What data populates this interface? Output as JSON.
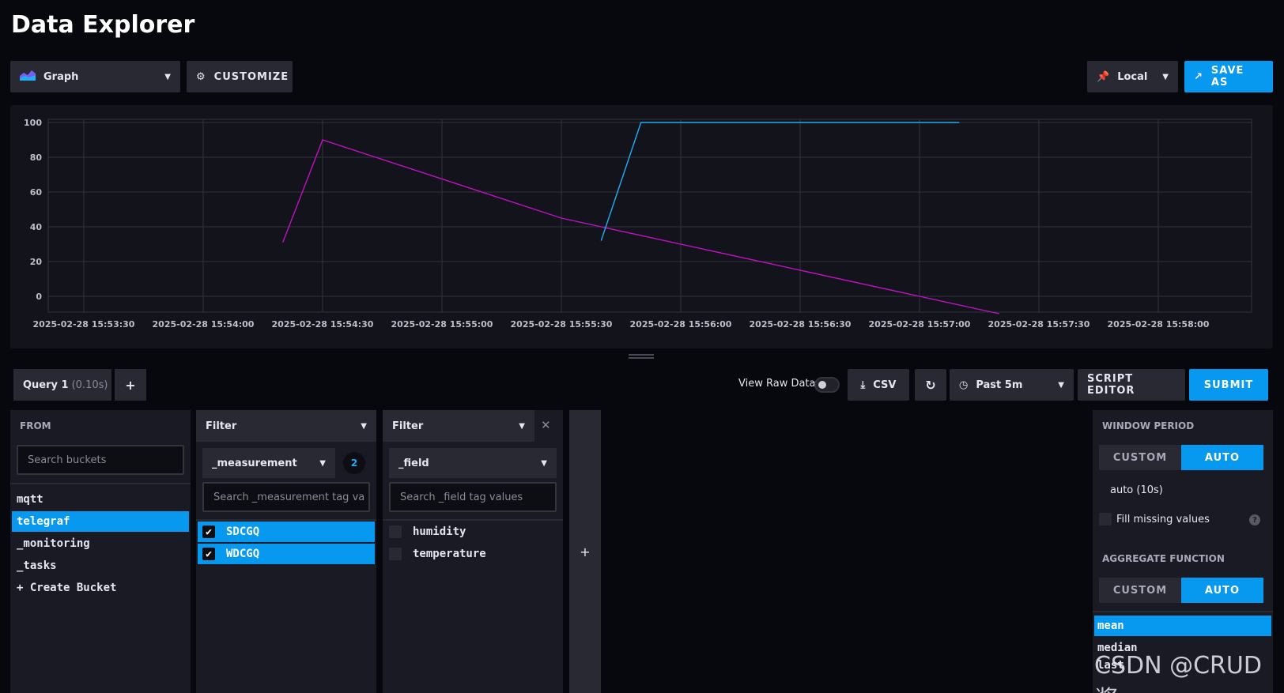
{
  "page": {
    "title": "Data Explorer"
  },
  "toolbar": {
    "graph_label": "Graph",
    "customize_label": "CUSTOMIZE",
    "timezone_label": "Local",
    "save_as_label": "SAVE AS"
  },
  "chart_data": {
    "type": "line",
    "ylim": [
      0,
      100
    ],
    "yticks": [
      "100",
      "80",
      "60",
      "40",
      "20",
      "0"
    ],
    "xticks": [
      "2025-02-28 15:53:30",
      "2025-02-28 15:54:00",
      "2025-02-28 15:54:30",
      "2025-02-28 15:55:00",
      "2025-02-28 15:55:30",
      "2025-02-28 15:56:00",
      "2025-02-28 15:56:30",
      "2025-02-28 15:57:00",
      "2025-02-28 15:57:30",
      "2025-02-28 15:58:00"
    ],
    "grid": true,
    "series": [
      {
        "color": "#c012c0",
        "x": [
          "2025-02-28 15:54:20",
          "2025-02-28 15:54:30",
          "2025-02-28 15:55:30",
          "2025-02-28 15:57:00",
          "2025-02-28 15:57:20"
        ],
        "y": [
          31,
          90,
          45,
          0,
          -10
        ]
      },
      {
        "color": "#22adf6",
        "x": [
          "2025-02-28 15:55:40",
          "2025-02-28 15:55:50",
          "2025-02-28 15:57:10"
        ],
        "y": [
          32,
          100,
          100
        ]
      }
    ]
  },
  "query": {
    "tab_name": "Query 1",
    "tab_time": "(0.10s)",
    "add_label": "+",
    "view_raw_label": "View Raw Data",
    "csv_label": "CSV",
    "time_range_label": "Past 5m",
    "script_editor_label": "SCRIPT EDITOR",
    "submit_label": "SUBMIT"
  },
  "from": {
    "header": "FROM",
    "search_placeholder": "Search buckets",
    "buckets": [
      "mqtt",
      "telegraf",
      "_monitoring",
      "_tasks"
    ],
    "selected": "telegraf",
    "create_label": "+ Create Bucket"
  },
  "filter1": {
    "header": "Filter",
    "key": "_measurement",
    "count": "2",
    "search_placeholder": "Search _measurement tag va",
    "values": [
      "SDCGQ",
      "WDCGQ"
    ]
  },
  "filter2": {
    "header": "Filter",
    "close_label": "✕",
    "key": "_field",
    "search_placeholder": "Search _field tag values",
    "values": [
      "humidity",
      "temperature"
    ]
  },
  "add_column_label": "+",
  "window": {
    "header": "WINDOW PERIOD",
    "custom_label": "CUSTOM",
    "auto_label": "AUTO",
    "period": "auto (10s)",
    "fill_label": "Fill missing values",
    "help_label": "?"
  },
  "aggregate": {
    "header": "AGGREGATE FUNCTION",
    "custom_label": "CUSTOM",
    "auto_label": "AUTO",
    "functions": [
      "mean",
      "median",
      "last"
    ]
  },
  "watermark": "CSDN @CRUD酱",
  "colors": {
    "accent": "#0798f0",
    "series_magenta": "#c012c0",
    "series_cyan": "#22adf6"
  }
}
